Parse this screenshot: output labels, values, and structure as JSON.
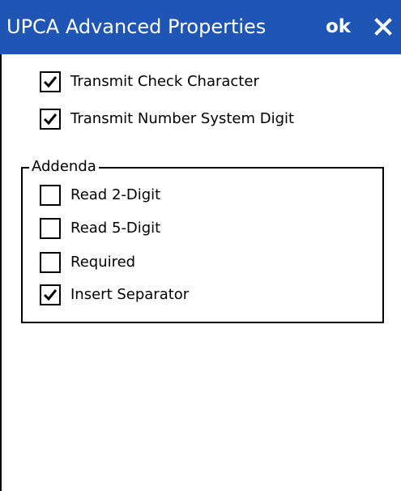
{
  "window": {
    "title": "UPCA Advanced Properties",
    "ok_label": "ok",
    "close_icon": "close-icon",
    "title_bar_color": "#1F55B5"
  },
  "options": {
    "transmit_check_character": {
      "label": "Transmit Check Character",
      "checked": true
    },
    "transmit_number_system_digit": {
      "label": "Transmit Number System Digit",
      "checked": true
    }
  },
  "addenda": {
    "title": "Addenda",
    "items": [
      {
        "label": "Read 2-Digit",
        "checked": false
      },
      {
        "label": "Read 5-Digit",
        "checked": false
      },
      {
        "label": "Required",
        "checked": false
      },
      {
        "label": "Insert Separator",
        "checked": true
      }
    ]
  }
}
